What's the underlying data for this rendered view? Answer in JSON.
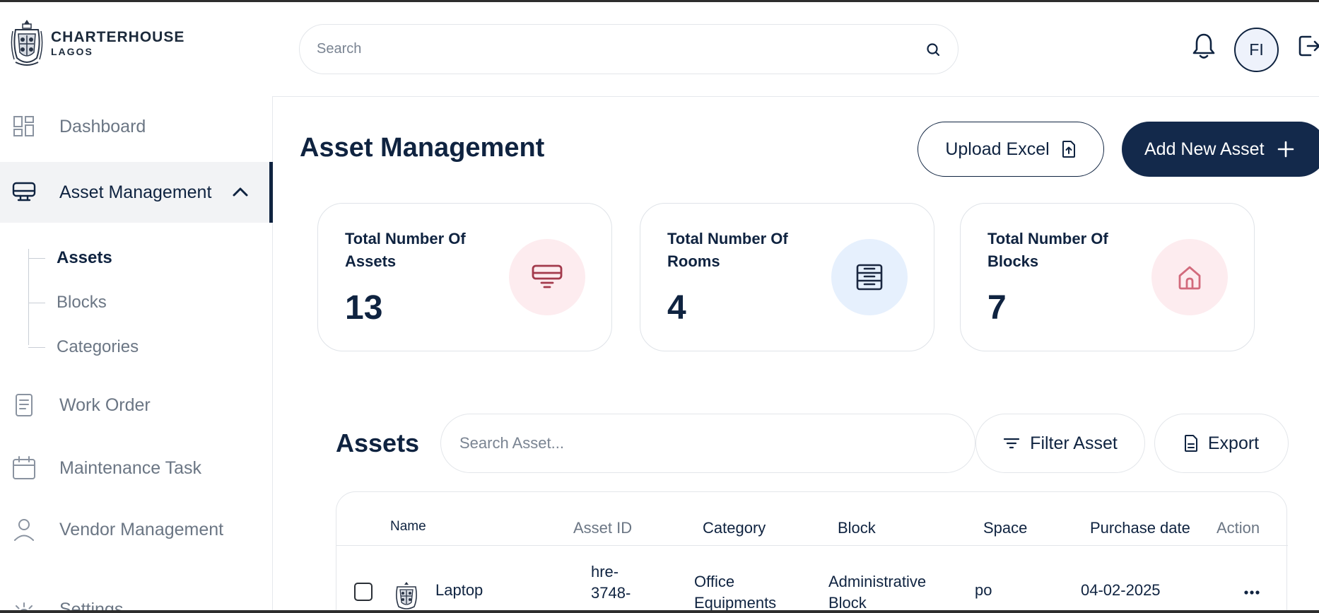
{
  "brand": {
    "name": "CHARTERHOUSE",
    "city": "LAGOS"
  },
  "header": {
    "search_placeholder": "Search",
    "avatar_initials": "FI"
  },
  "sidebar": {
    "items": [
      {
        "label": "Dashboard"
      },
      {
        "label": "Asset Management"
      },
      {
        "label": "Work Order"
      },
      {
        "label": "Maintenance Task"
      },
      {
        "label": "Vendor Management"
      },
      {
        "label": "Settings"
      }
    ],
    "sub_items": [
      {
        "label": "Assets"
      },
      {
        "label": "Blocks"
      },
      {
        "label": "Categories"
      }
    ]
  },
  "main": {
    "title": "Asset Management",
    "upload_label": "Upload Excel",
    "add_label": "Add New Asset",
    "stats": [
      {
        "label": "Total Number Of Assets",
        "value": "13",
        "icon": "monitor-icon",
        "icon_bg": "#fdecef",
        "icon_color": "#a33a4c"
      },
      {
        "label": "Total Number Of Rooms",
        "value": "4",
        "icon": "stack-icon",
        "icon_bg": "#e6f0fd",
        "icon_color": "#1a2740"
      },
      {
        "label": "Total Number Of Blocks",
        "value": "7",
        "icon": "home-icon",
        "icon_bg": "#fdecef",
        "icon_color": "#d26a7c"
      }
    ],
    "assets": {
      "title": "Assets",
      "search_placeholder": "Search Asset...",
      "filter_label": "Filter Asset",
      "export_label": "Export",
      "columns": [
        "Name",
        "Asset ID",
        "Category",
        "Block",
        "Space",
        "Purchase date",
        "Action"
      ],
      "rows": [
        {
          "name": "Laptop",
          "asset_id_line1": "hre-",
          "asset_id_line2": "3748-",
          "category_line1": "Office",
          "category_line2": "Equipments",
          "block_line1": "Administrative",
          "block_line2": "Block",
          "space": "po",
          "purchase_date": "04-02-2025"
        }
      ]
    }
  },
  "colors": {
    "primary": "#13294b",
    "muted": "#6b7684",
    "border": "#e3e6ea"
  }
}
